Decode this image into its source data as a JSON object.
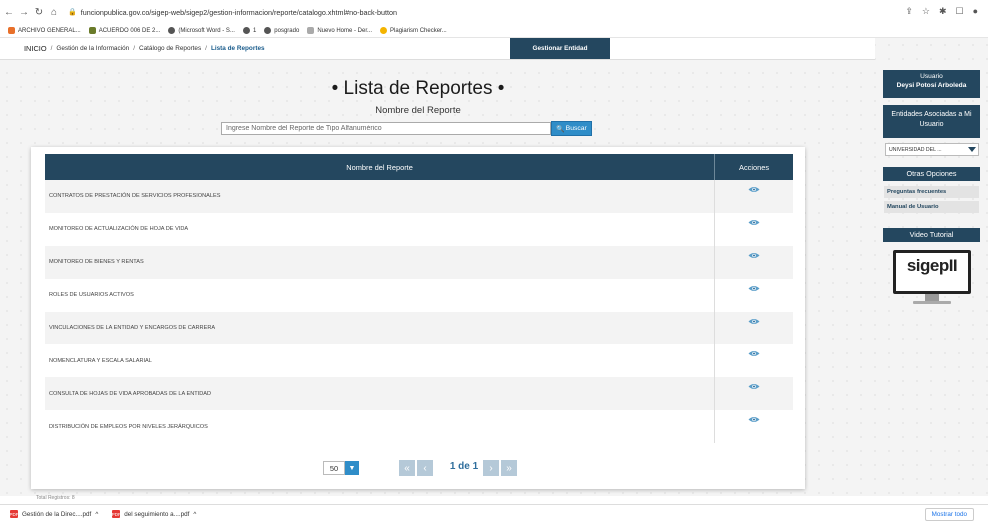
{
  "browser": {
    "url": "funcionpublica.gov.co/sigep-web/sigep2/gestion-informacion/reporte/catalogo.xhtml#no-back-button",
    "bookmarks": [
      "ARCHIVO GENERAL...",
      "ACUERDO 006 DE 2...",
      "(Microsoft Word - S...",
      "1",
      "posgrado",
      "Nuevo Home - Der...",
      "Plagiarism Checker..."
    ]
  },
  "breadcrumb": {
    "home": "INICIO",
    "items": [
      "Gestión de la Información",
      "Catálogo de Reportes",
      "Lista de Reportes"
    ]
  },
  "gestionar_label": "Gestionar Entidad",
  "title": "• Lista de Reportes •",
  "search": {
    "label": "Nombre del Reporte",
    "placeholder": "Ingrese Nombre del Reporte de Tipo Alfanumérico",
    "button": "Buscar"
  },
  "table": {
    "headers": [
      "Nombre del Reporte",
      "Acciones"
    ],
    "rows": [
      "CONTRATOS DE PRESTACIÓN DE SERVICIOS PROFESIONALES",
      "MONITOREO DE ACTUALIZACIÓN DE HOJA DE VIDA",
      "MONITOREO DE BIENES Y RENTAS",
      "ROLES DE USUARIOS ACTIVOS",
      "VINCULACIONES DE LA ENTIDAD Y ENCARGOS DE CARRERA",
      "NOMENCLATURA Y ESCALA SALARIAL",
      "CONSULTA DE HOJAS DE VIDA APROBADAS DE LA ENTIDAD",
      "DISTRIBUCIÓN DE EMPLEOS POR NIVELES JERÁRQUICOS"
    ]
  },
  "pager": {
    "page_size": "50",
    "info": "1 de 1"
  },
  "sidebar": {
    "user_label": "Usuario",
    "user_name": "Deysi Potosí Arboleda",
    "entities_label": "Entidades Asociadas a Mi Usuario",
    "entity_selected": "UNIVERSIDAD DEL ...",
    "otras_label": "Otras Opciones",
    "options": [
      "Preguntas frecuentes",
      "Manual de Usuario"
    ],
    "video_label": "Video Tutorial",
    "logo_text": "sigepII"
  },
  "footer_text": "Total Registros: 8",
  "downloads": [
    "Gestión de la Direc....pdf",
    "del seguimiento a....pdf"
  ],
  "show_all": "Mostrar todo",
  "colors": {
    "navy": "#24475f",
    "accent": "#2f8dc8"
  }
}
